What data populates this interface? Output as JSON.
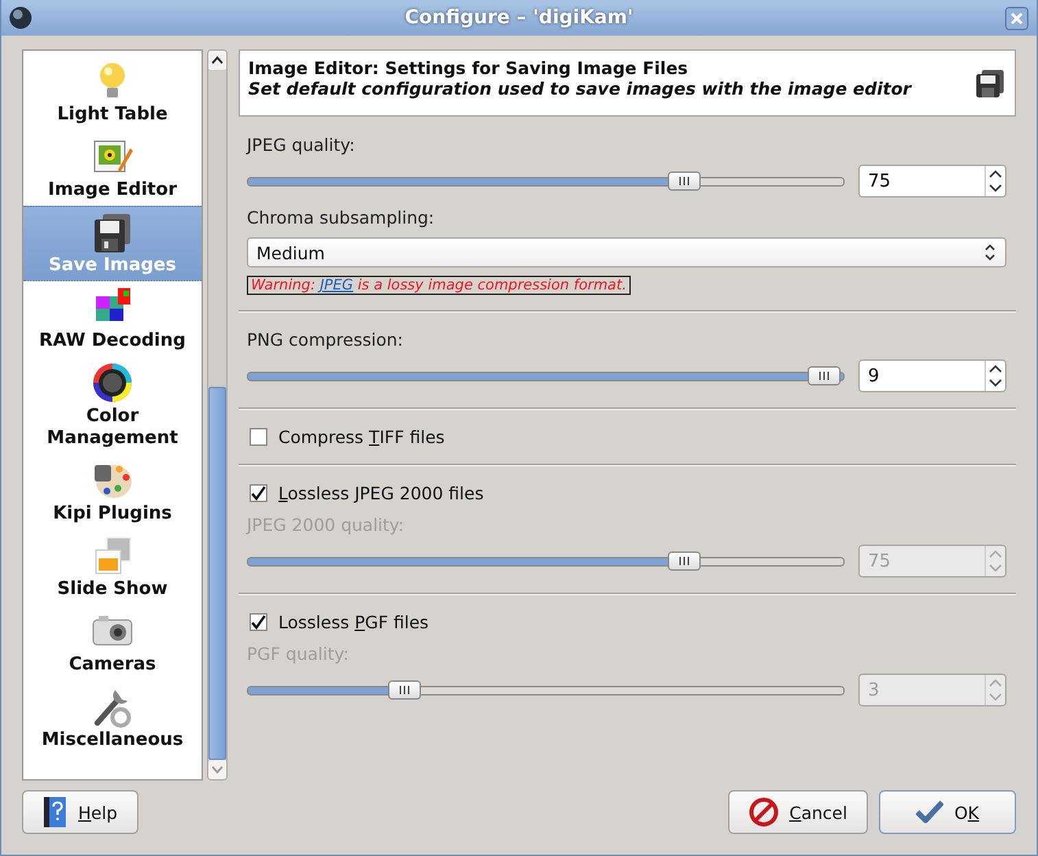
{
  "window": {
    "title": "Configure – 'digiKam'"
  },
  "sidebar": {
    "items": [
      {
        "label": "Light Table",
        "selected": false
      },
      {
        "label": "Image Editor",
        "selected": false
      },
      {
        "label": "Save Images",
        "selected": true
      },
      {
        "label": "RAW Decoding",
        "selected": false
      },
      {
        "label": "Color Management",
        "selected": false
      },
      {
        "label": "Kipi Plugins",
        "selected": false
      },
      {
        "label": "Slide Show",
        "selected": false
      },
      {
        "label": "Cameras",
        "selected": false
      },
      {
        "label": "Miscellaneous",
        "selected": false
      }
    ]
  },
  "header": {
    "title": "Image Editor: Settings for Saving Image Files",
    "subtitle": "Set default configuration used to save images with the image editor"
  },
  "sections": [
    {
      "rows": [
        {
          "kind": "label",
          "text": "JPEG quality:",
          "disabled": false
        },
        {
          "kind": "slider",
          "level": 0.75,
          "value": "75",
          "disabled": false
        },
        {
          "kind": "label",
          "text": "Chroma subsampling:",
          "disabled": false
        },
        {
          "kind": "dropdown",
          "value": "Medium"
        },
        {
          "kind": "warning",
          "before": "Warning: ",
          "link": "JPEG",
          "after": " is a lossy image compression format."
        }
      ]
    },
    {
      "rows": [
        {
          "kind": "label",
          "text": "PNG compression:",
          "disabled": false
        },
        {
          "kind": "slider",
          "level": 1.0,
          "value": "9",
          "disabled": false
        }
      ]
    },
    {
      "rows": [
        {
          "kind": "checkbox",
          "label": {
            "before": "Compress ",
            "key": "T",
            "after": "IFF files"
          },
          "checked": false
        }
      ]
    },
    {
      "rows": [
        {
          "kind": "checkbox",
          "label": {
            "key": "L",
            "after": "ossless JPEG 2000 files"
          },
          "checked": true
        },
        {
          "kind": "label",
          "text": "JPEG 2000 quality:",
          "disabled": true
        },
        {
          "kind": "slider",
          "level": 0.75,
          "value": "75",
          "disabled": true
        }
      ]
    },
    {
      "rows": [
        {
          "kind": "checkbox",
          "label": {
            "before": "Lossless ",
            "key": "P",
            "after": "GF files"
          },
          "checked": true
        },
        {
          "kind": "label",
          "text": "PGF quality:",
          "disabled": true
        },
        {
          "kind": "slider",
          "level": 0.25,
          "value": "3",
          "disabled": true
        }
      ]
    }
  ],
  "buttons": [
    {
      "kind": "help",
      "label": {
        "key": "H",
        "after": "elp"
      }
    },
    {
      "kind": "cancel",
      "label": {
        "key": "C",
        "after": "ancel"
      }
    },
    {
      "kind": "ok",
      "label": {
        "before": "O",
        "key": "K"
      }
    }
  ]
}
